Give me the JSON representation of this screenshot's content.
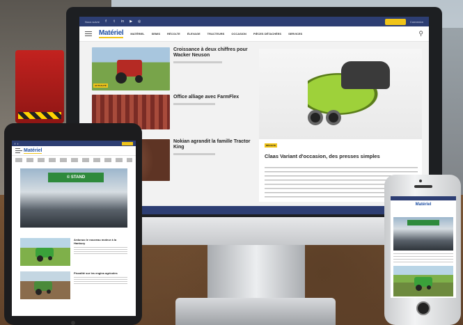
{
  "desktop": {
    "topbar": {
      "left_text": "Nous suivre",
      "subscribe_label": "S'abonner",
      "right_link": "Connexion",
      "social_icons": [
        "facebook-icon",
        "twitter-icon",
        "linkedin-icon",
        "youtube-icon",
        "instagram-icon"
      ]
    },
    "logo": "Matériel",
    "nav": [
      "MATÉRIEL",
      "SEMIS",
      "RÉCOLTE",
      "ÉLEVAGE",
      "TRACTEURS",
      "OCCASION",
      "PIÈCES DÉTACHÉES",
      "SERVICES"
    ],
    "articles": [
      {
        "title": "Croissance à deux chiffres pour Wacker Neuson",
        "tag": "ACTUALITÉ"
      },
      {
        "title": "Office alliage avec FarmFlex"
      },
      {
        "title": "Nokian agrandit la famille Tractor King"
      }
    ],
    "featured": {
      "tag": "RÉCOLTE",
      "title": "Claas Variant d'occasion, des presses simples"
    },
    "colors": {
      "brand": "#2d3e73",
      "accent": "#f0c419",
      "logo": "#1f4fa3"
    }
  },
  "tablet": {
    "logo": "Matériel",
    "hero_sign": "© STAND",
    "rows": [
      {
        "title": "Ardunuo le nouveau moteur à la Hanbury"
      },
      {
        "title": "Fiscalité sur les engins agricoles"
      }
    ]
  },
  "phone": {
    "logo": "Matériel"
  }
}
